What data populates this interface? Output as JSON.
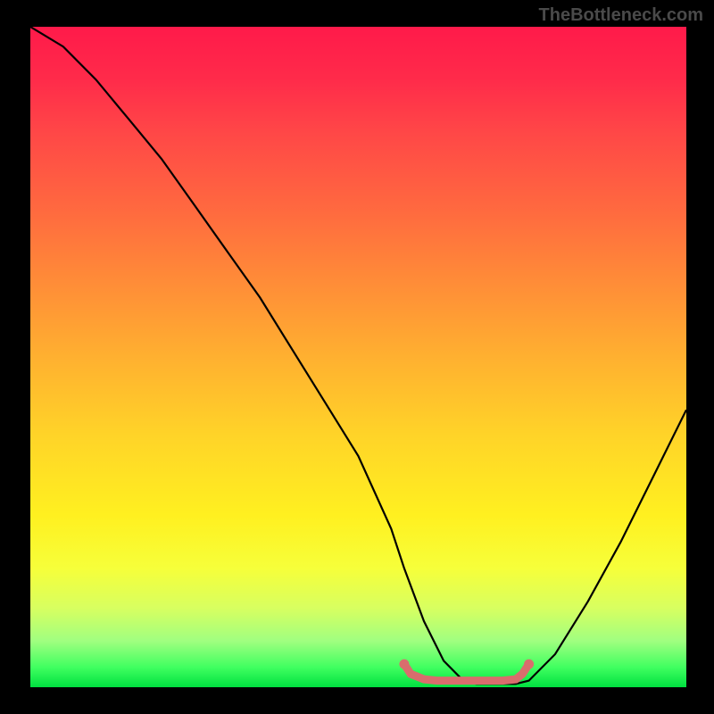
{
  "watermark": "TheBottleneck.com",
  "chart_data": {
    "type": "line",
    "title": "",
    "xlabel": "",
    "ylabel": "",
    "xlim": [
      0,
      100
    ],
    "ylim": [
      0,
      100
    ],
    "series": [
      {
        "name": "bottleneck-curve",
        "x": [
          0,
          5,
          10,
          15,
          20,
          25,
          30,
          35,
          40,
          45,
          50,
          55,
          57,
          60,
          63,
          66,
          68,
          70,
          72,
          74,
          76,
          80,
          85,
          90,
          95,
          100
        ],
        "y": [
          100,
          97,
          92,
          86,
          80,
          73,
          66,
          59,
          51,
          43,
          35,
          24,
          18,
          10,
          4,
          1,
          0.5,
          0.5,
          0.5,
          0.5,
          1,
          5,
          13,
          22,
          32,
          42
        ]
      },
      {
        "name": "optimal-range-marker",
        "x": [
          57,
          58,
          60,
          62,
          64,
          66,
          68,
          70,
          72,
          74,
          75,
          76
        ],
        "y": [
          3.5,
          2.0,
          1.2,
          1.0,
          1.0,
          1.0,
          1.0,
          1.0,
          1.0,
          1.2,
          2.0,
          3.5
        ]
      }
    ],
    "gradient": {
      "top": "#ff1a4a",
      "mid": "#fff020",
      "bottom": "#00e040"
    },
    "marker_color": "#d96d6d"
  }
}
